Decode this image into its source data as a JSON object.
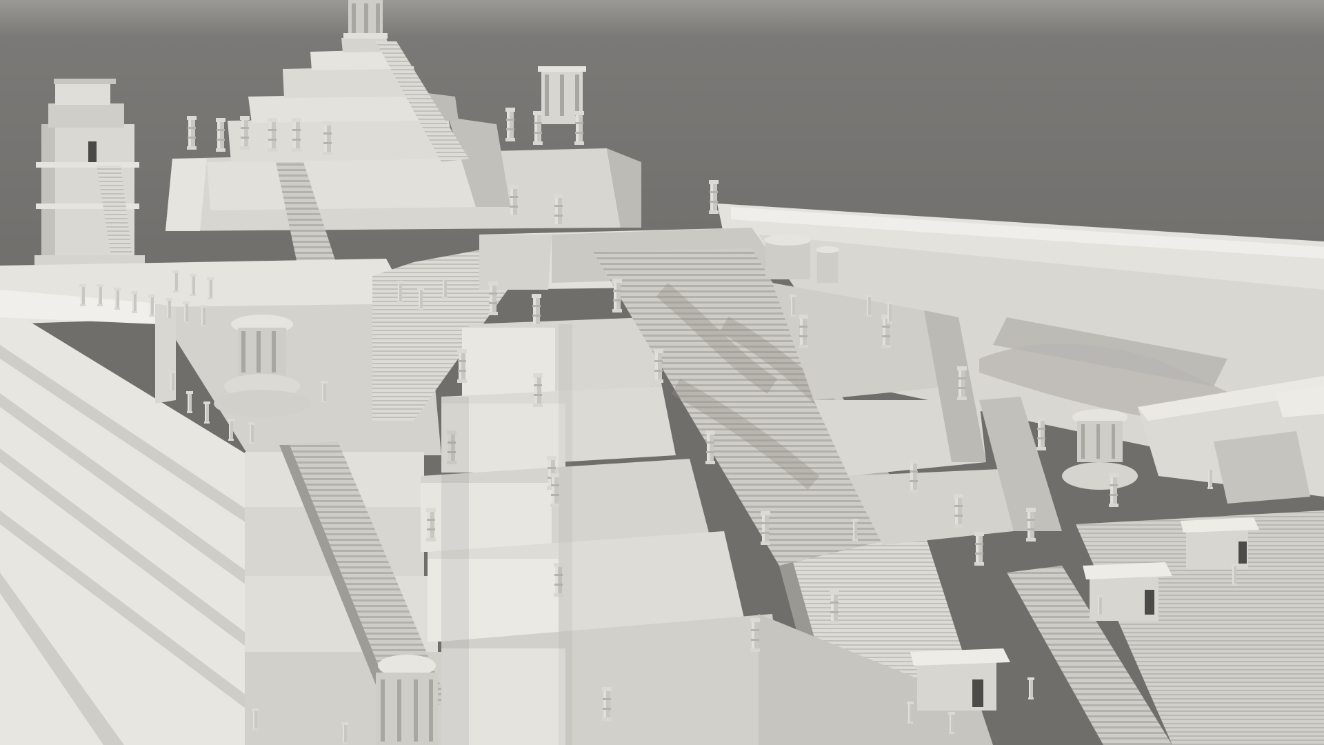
{
  "scene": {
    "subject": "untextured-3d-render-stepped-temple-complex",
    "colors": {
      "sky_top": "#9a9996",
      "sky": "#6f6e6b",
      "stone_light": "#e9e7e2",
      "stone_mid": "#d4d2cc",
      "stone_shade": "#b9b7b1",
      "stone_dark": "#9c9a94",
      "shadow": "#8d8c88"
    }
  }
}
